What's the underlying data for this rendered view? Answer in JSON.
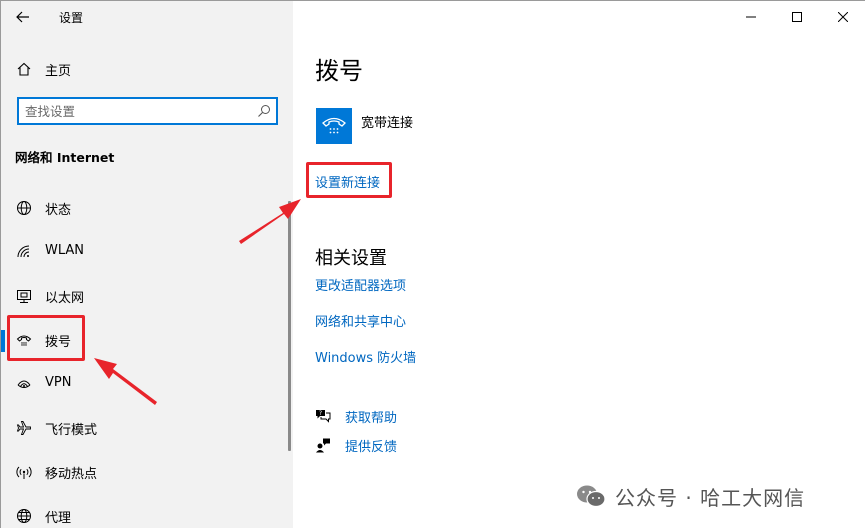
{
  "window": {
    "title": "设置"
  },
  "sidebar": {
    "home_label": "主页",
    "search": {
      "placeholder": "查找设置",
      "value": ""
    },
    "section_title": "网络和 Internet",
    "items": [
      {
        "label": "状态",
        "icon": "status-globe-icon"
      },
      {
        "label": "WLAN",
        "icon": "wifi-icon"
      },
      {
        "label": "以太网",
        "icon": "ethernet-icon"
      },
      {
        "label": "拨号",
        "icon": "dialup-icon",
        "selected": true
      },
      {
        "label": "VPN",
        "icon": "vpn-icon"
      },
      {
        "label": "飞行模式",
        "icon": "airplane-icon"
      },
      {
        "label": "移动热点",
        "icon": "hotspot-icon"
      },
      {
        "label": "代理",
        "icon": "proxy-globe-icon"
      }
    ]
  },
  "main": {
    "title": "拨号",
    "connection": {
      "name": "宽带连接",
      "icon": "dialup-phone-icon"
    },
    "setup_link": "设置新连接",
    "related": {
      "title": "相关设置",
      "links": [
        "更改适配器选项",
        "网络和共享中心",
        "Windows 防火墙"
      ]
    },
    "help": [
      {
        "label": "获取帮助",
        "icon": "help-chat-icon"
      },
      {
        "label": "提供反馈",
        "icon": "feedback-icon"
      }
    ]
  },
  "watermark": {
    "text": "公众号 · 哈工大网信"
  },
  "colors": {
    "accent": "#0078d7",
    "link": "#0067c0",
    "annotation": "#e8242b",
    "sidebar_bg": "#f2f2f2"
  }
}
